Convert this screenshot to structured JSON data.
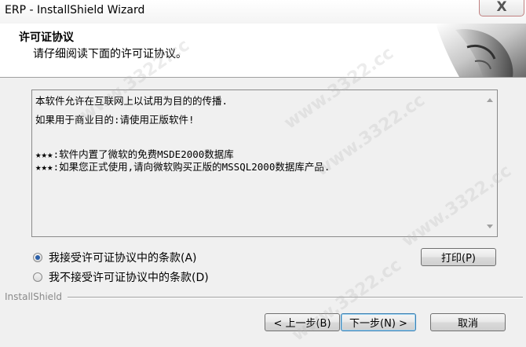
{
  "window": {
    "title": "ERP - InstallShield Wizard",
    "close_glyph": "X"
  },
  "header": {
    "title": "许可证协议",
    "subtitle": "请仔细阅读下面的许可证协议。"
  },
  "license": {
    "lines": [
      "本软件允许在互联网上以试用为目的的传播.",
      "如果用于商业目的:请使用正版软件!",
      "★★★:软件内置了微软的免费MSDE2000数据库",
      "★★★:如果您正式使用,请向微软购买正版的MSSQL2000数据库产品."
    ]
  },
  "radios": {
    "accept": {
      "label": "我接受许可证协议中的条款(A)",
      "checked": true
    },
    "decline": {
      "label": "我不接受许可证协议中的条款(D)",
      "checked": false
    }
  },
  "buttons": {
    "print": "打印(P)",
    "back": "< 上一步(B)",
    "next": "下一步(N) >",
    "cancel": "取消"
  },
  "footer": {
    "brand": "InstallShield"
  },
  "watermark": {
    "text": "www.3322.cc"
  }
}
